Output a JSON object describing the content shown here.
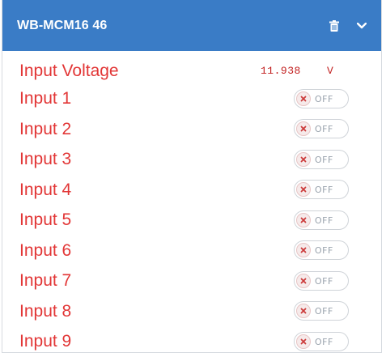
{
  "header": {
    "title": "WB-MCM16 46",
    "background": "#3a7cc6",
    "actions": [
      {
        "icon": "trash-icon"
      },
      {
        "icon": "chevron-down-icon"
      }
    ]
  },
  "voltage": {
    "label": "Input Voltage",
    "value": "11.938",
    "unit": "V"
  },
  "inputs": [
    {
      "label": "Input 1",
      "toggle_text": "OFF"
    },
    {
      "label": "Input 2",
      "toggle_text": "OFF"
    },
    {
      "label": "Input 3",
      "toggle_text": "OFF"
    },
    {
      "label": "Input 4",
      "toggle_text": "OFF"
    },
    {
      "label": "Input 5",
      "toggle_text": "OFF"
    },
    {
      "label": "Input 6",
      "toggle_text": "OFF"
    },
    {
      "label": "Input 7",
      "toggle_text": "OFF"
    },
    {
      "label": "Input 8",
      "toggle_text": "OFF"
    },
    {
      "label": "Input 9",
      "toggle_text": "OFF"
    }
  ],
  "colors": {
    "label_red": "#e23636",
    "value_red": "#c11d1d",
    "toggle_off_knob": "#f6eaea"
  }
}
